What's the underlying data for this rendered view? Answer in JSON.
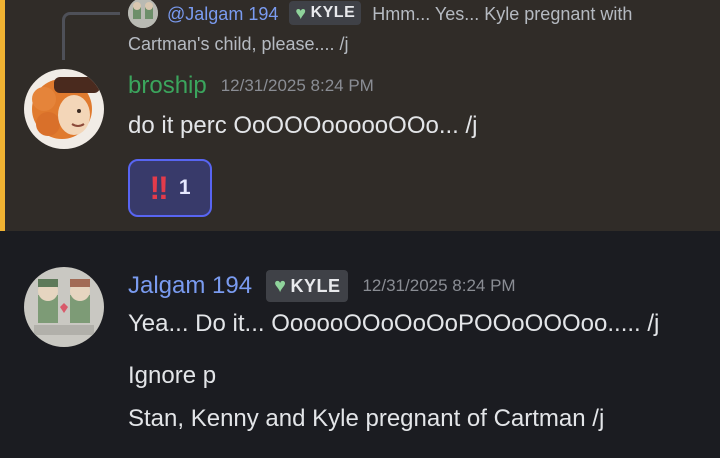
{
  "reply": {
    "mention": "@Jalgam 194",
    "role_tag": "KYLE",
    "text_line1": "Hmm... Yes... Kyle pregnant with",
    "text_line2": "Cartman's child, please.... /j"
  },
  "messages": [
    {
      "username": "broship",
      "username_color": "#3ba55d",
      "timestamp": "12/31/2025 8:24 PM",
      "lines": [
        "do it perc OoOOOoooooOOo... /j"
      ],
      "reaction": {
        "emoji": "!!",
        "count": "1"
      }
    },
    {
      "username": "Jalgam 194",
      "username_color": "#7a9bf0",
      "role_tag": "KYLE",
      "timestamp": "12/31/2025 8:24 PM",
      "lines": [
        "Yea... Do it... OooooOOoOoOoPOOoOOOoo..... /j",
        "Ignore p",
        "Stan, Kenny and Kyle pregnant of Cartman /j"
      ]
    }
  ],
  "colors": {
    "highlight_bg": "#302c28",
    "highlight_bar": "#f0b232",
    "background": "#1b1c21",
    "reaction_border": "#5865f2"
  }
}
